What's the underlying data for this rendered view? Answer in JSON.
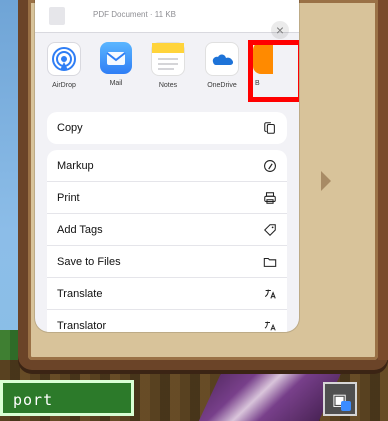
{
  "sheet": {
    "header_meta": "PDF Document · 11 KB",
    "close_label": "×"
  },
  "apps": [
    {
      "label": "AirDrop",
      "icon": "airdrop-icon"
    },
    {
      "label": "Mail",
      "icon": "mail-icon"
    },
    {
      "label": "Notes",
      "icon": "notes-icon"
    },
    {
      "label": "OneDrive",
      "icon": "onedrive-icon"
    },
    {
      "label": "B",
      "icon": "partial-app-icon"
    }
  ],
  "actions": {
    "copy": {
      "label": "Copy",
      "icon": "copy-icon"
    },
    "list": [
      {
        "label": "Markup",
        "icon": "markup-icon"
      },
      {
        "label": "Print",
        "icon": "print-icon"
      },
      {
        "label": "Add Tags",
        "icon": "tag-icon"
      },
      {
        "label": "Save to Files",
        "icon": "folder-icon"
      },
      {
        "label": "Translate",
        "icon": "translate-icon"
      },
      {
        "label": "Translator",
        "icon": "translator-icon"
      }
    ]
  },
  "game_ui": {
    "report_label": "port",
    "book_button": "book"
  },
  "colors": {
    "highlight": "#ff0000",
    "sheet_bg": "#f2f2f6",
    "accent_blue": "#2f7ef5",
    "minecraft_green": "#2c7a2a"
  }
}
